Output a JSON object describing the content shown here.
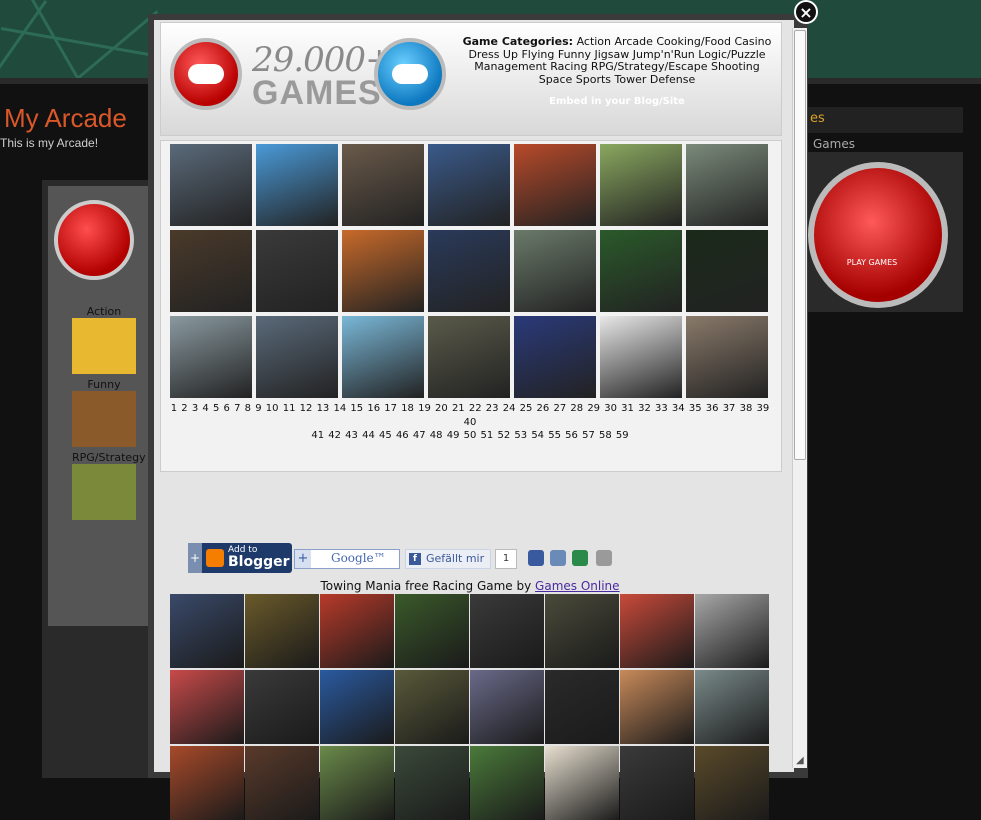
{
  "background": {
    "site_title": "My Arcade",
    "site_subtitle": "This is my Arcade!",
    "sidebar_categories": [
      "Action",
      "Funny",
      "RPG/Strategy"
    ],
    "right_panel_heading": "es",
    "right_panel_link": "Games",
    "right_logo_caption": "PLAY GAMES"
  },
  "modal": {
    "close_symbol": "×",
    "header": {
      "count_number": "29.000+",
      "count_label": "GAMES",
      "categories_title": "Game Categories:",
      "categories_text": "Action Arcade Cooking/Food Casino Dress Up Flying Funny Jigsaw Jump'n'Run Logic/Puzzle Management Racing RPG/Strategy/Escape Shooting Space Sports Tower Defense",
      "embed_label": "Embed in your Blog/Site"
    },
    "games": [
      {
        "name": "thumb-1",
        "color": "#5a6a7a"
      },
      {
        "name": "thumb-2",
        "color": "#4a9ad8"
      },
      {
        "name": "thumb-3",
        "color": "#6a5a4a"
      },
      {
        "name": "thumb-4",
        "color": "#3a5a8a"
      },
      {
        "name": "thumb-5",
        "color": "#b84a2a"
      },
      {
        "name": "thumb-6",
        "color": "#8aa860"
      },
      {
        "name": "thumb-7",
        "color": "#7a8a7a"
      },
      {
        "name": "thumb-8",
        "color": "#4a3a2a"
      },
      {
        "name": "thumb-9",
        "color": "#3a3a3a"
      },
      {
        "name": "thumb-10",
        "color": "#c86a2a"
      },
      {
        "name": "thumb-11",
        "color": "#2a3a5a"
      },
      {
        "name": "thumb-12",
        "color": "#6a7a6a"
      },
      {
        "name": "thumb-13",
        "color": "#2a5a2a"
      },
      {
        "name": "thumb-14",
        "color": "#1a2a1a"
      },
      {
        "name": "thumb-15",
        "color": "#8a9aa0"
      },
      {
        "name": "thumb-16",
        "color": "#5a6a7a"
      },
      {
        "name": "thumb-17",
        "color": "#7ab8d8"
      },
      {
        "name": "thumb-18",
        "color": "#5a5a4a"
      },
      {
        "name": "thumb-19",
        "color": "#2a3a7a"
      },
      {
        "name": "thumb-20",
        "color": "#e8e8e8"
      },
      {
        "name": "thumb-21",
        "color": "#8a7a6a"
      }
    ],
    "pages_row1": [
      "1",
      "2",
      "3",
      "4",
      "5",
      "6",
      "7",
      "8",
      "9",
      "10",
      "11",
      "12",
      "13",
      "14",
      "15",
      "16",
      "17",
      "18",
      "19",
      "20",
      "21",
      "22",
      "23",
      "24",
      "25",
      "26",
      "27",
      "28",
      "29",
      "30",
      "31",
      "32",
      "33",
      "34",
      "35",
      "36",
      "37",
      "38",
      "39",
      "40"
    ],
    "pages_row2": [
      "41",
      "42",
      "43",
      "44",
      "45",
      "46",
      "47",
      "48",
      "49",
      "50",
      "51",
      "52",
      "53",
      "54",
      "55",
      "56",
      "57",
      "58",
      "59"
    ],
    "share": {
      "blogger_small": "Add to",
      "blogger_big": "Blogger",
      "google_label": "Google™",
      "like_label": "Gefällt mir",
      "like_count": "1"
    },
    "caption_text": "Towing Mania free Racing Game by",
    "caption_link": "Games Online",
    "recommended": [
      {
        "color": "#3a4a6a"
      },
      {
        "color": "#6a5a2a"
      },
      {
        "color": "#b83a2a"
      },
      {
        "color": "#3a5a2a"
      },
      {
        "color": "#3a3a3a"
      },
      {
        "color": "#4a4a3a"
      },
      {
        "color": "#c84a3a"
      },
      {
        "color": "#a8a8a8"
      },
      {
        "color": "#c84a4a"
      },
      {
        "color": "#3a3a3a"
      },
      {
        "color": "#2a5aa0"
      },
      {
        "color": "#5a5a3a"
      },
      {
        "color": "#6a6a8a"
      },
      {
        "color": "#2a2a2a"
      },
      {
        "color": "#c88a5a"
      },
      {
        "color": "#7a8a8a"
      },
      {
        "color": "#a84a2a"
      },
      {
        "color": "#5a3a2a"
      },
      {
        "color": "#6a8a4a"
      },
      {
        "color": "#3a4a3a"
      },
      {
        "color": "#4a7a3a"
      },
      {
        "color": "#e8e0d0"
      },
      {
        "color": "#3a3a3a"
      },
      {
        "color": "#5a4a2a"
      }
    ]
  }
}
